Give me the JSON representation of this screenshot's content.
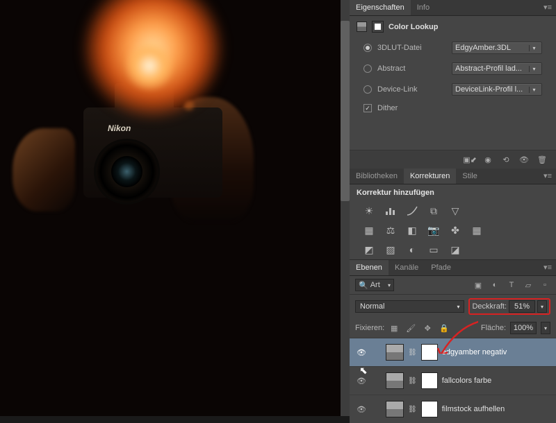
{
  "canvas": {
    "brand": "Nikon"
  },
  "props": {
    "tab1": "Eigenschaften",
    "tab2": "Info",
    "title": "Color Lookup",
    "radio1": "3DLUT-Datei",
    "radio2": "Abstract",
    "radio3": "Device-Link",
    "check1": "Dither",
    "dd1": "EdgyAmber.3DL",
    "dd2": "Abstract-Profil lad...",
    "dd3": "DeviceLink-Profil l..."
  },
  "libs": {
    "tab1": "Bibliotheken",
    "tab2": "Korrekturen",
    "tab3": "Stile",
    "add": "Korrektur hinzufügen"
  },
  "layers": {
    "tab1": "Ebenen",
    "tab2": "Kanäle",
    "tab3": "Pfade",
    "filter_prefix": "🔍",
    "filter": "Art",
    "blend": "Normal",
    "opacity_label": "Deckkraft:",
    "opacity": "51%",
    "lock_label": "Fixieren:",
    "fill_label": "Fläche:",
    "fill": "100%",
    "items": [
      {
        "name": "edgyamber negativ"
      },
      {
        "name": "fallcolors farbe"
      },
      {
        "name": "filmstock aufhellen"
      }
    ]
  }
}
